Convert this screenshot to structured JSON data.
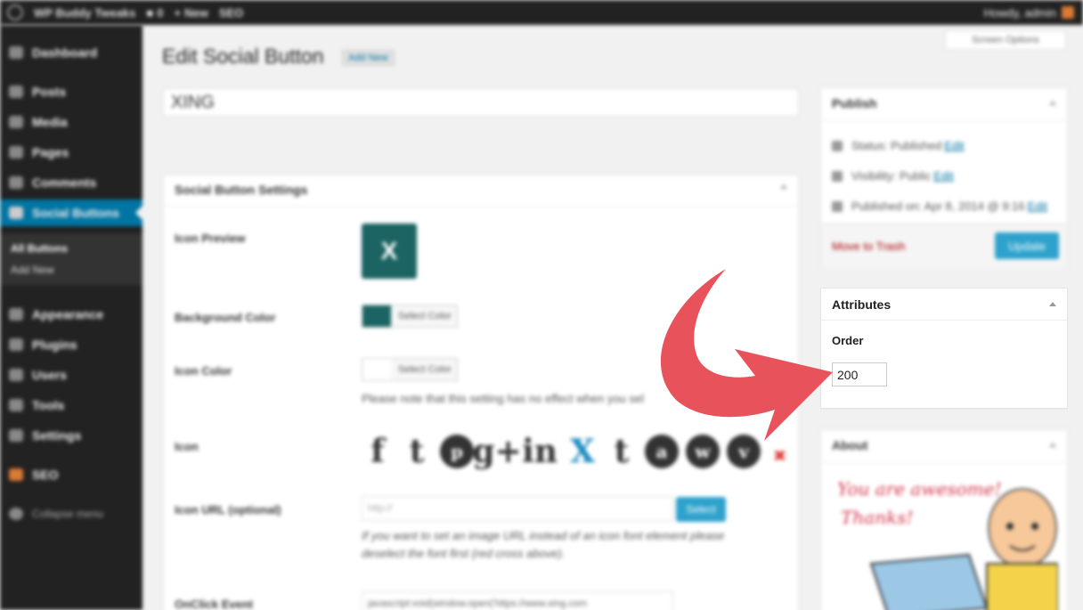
{
  "admin_bar": {
    "site_name": "WP Buddy Tweaks",
    "comments_count": "0",
    "new_label": "New",
    "seo_label": "SEO",
    "greeting": "Howdy, admin"
  },
  "sidebar": {
    "items": [
      {
        "label": "Dashboard",
        "icon": "dashboard-icon"
      },
      {
        "label": "Posts",
        "icon": "pin-icon"
      },
      {
        "label": "Media",
        "icon": "media-icon"
      },
      {
        "label": "Pages",
        "icon": "pages-icon"
      },
      {
        "label": "Comments",
        "icon": "comment-icon"
      },
      {
        "label": "Social Buttons",
        "icon": "share-icon"
      },
      {
        "label": "Appearance",
        "icon": "brush-icon"
      },
      {
        "label": "Plugins",
        "icon": "plug-icon"
      },
      {
        "label": "Users",
        "icon": "user-icon"
      },
      {
        "label": "Tools",
        "icon": "wrench-icon"
      },
      {
        "label": "Settings",
        "icon": "settings-icon"
      },
      {
        "label": "SEO",
        "icon": "seo-icon"
      },
      {
        "label": "Collapse menu",
        "icon": "collapse-icon"
      }
    ],
    "submenu": [
      "All Buttons",
      "Add New"
    ]
  },
  "header": {
    "title": "Edit Social Button",
    "add_new": "Add New",
    "screen_options": "Screen Options"
  },
  "post_title": "XING",
  "settings": {
    "box_title": "Social Button Settings",
    "icon_preview_label": "Icon Preview",
    "preview_glyph": "X",
    "bg_color_label": "Background Color",
    "select_color": "Select Color",
    "icon_color_label": "Icon Color",
    "icon_color_note": "Please note that this setting has no effect when you sel",
    "icon_label": "Icon",
    "icons": [
      "f",
      "t",
      "p",
      "g+",
      "in",
      "X",
      "t",
      "a",
      "w",
      "v"
    ],
    "icon_url_label": "Icon URL (optional)",
    "icon_url_placeholder": "http://",
    "icon_url_button": "Select",
    "icon_url_note_1": "If you want to set an image URL instead of an icon font element please",
    "icon_url_note_2": "deselect the font first (red cross above).",
    "onclick_label": "OnClick Event",
    "onclick_value": "javascript:void(window.open('https://www.xing.com"
  },
  "publish": {
    "title": "Publish",
    "status": "Status: Published",
    "visibility": "Visibility: Public",
    "published_on": "Published on: Apr 8, 2014 @ 9:16",
    "edit": "Edit",
    "trash": "Move to Trash",
    "update": "Update"
  },
  "attributes": {
    "title": "Attributes",
    "order_label": "Order",
    "order_value": "200"
  },
  "about": {
    "title": "About",
    "line1": "You are awesome!",
    "line2": "Thanks!"
  },
  "colors": {
    "wp_blue": "#0074a2",
    "button_blue": "#2ea2cc",
    "xing_green": "#1b6463",
    "arrow_red": "#e8525a"
  }
}
